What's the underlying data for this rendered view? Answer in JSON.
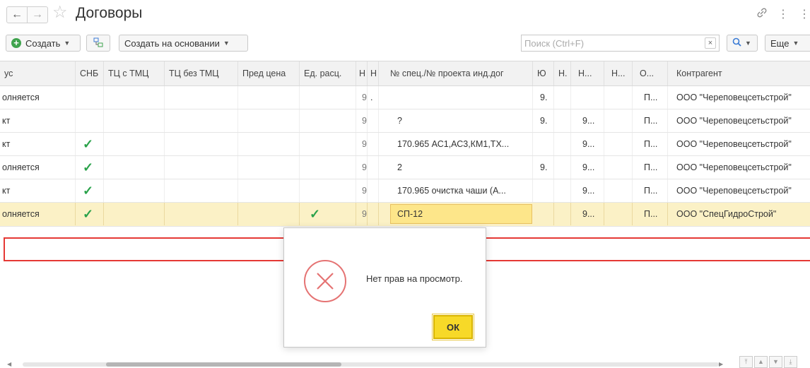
{
  "window": {
    "title": "Договоры",
    "back_icon": "←",
    "forward_icon": "→",
    "star_icon": "☆",
    "link_icon": "🔗",
    "more_icon": "⋮"
  },
  "toolbar": {
    "create_label": "Создать",
    "create_based_label": "Создать на основании",
    "search_placeholder": "Поиск (Ctrl+F)",
    "search_clear": "×",
    "search_button": "🔍",
    "more_label": "Еще"
  },
  "table": {
    "columns": [
      "ус",
      "СНБ",
      "ТЦ с ТМЦ",
      "ТЦ без ТМЦ",
      "Пред цена",
      "Ед. расц.",
      "Н",
      "Н",
      "№ спец./№ проекта инд.дог",
      "Ю",
      "Н.",
      "Н...",
      "Н...",
      "О...",
      "Контрагент"
    ],
    "rows": [
      {
        "status": "олняется",
        "snb": "",
        "ed": "",
        "h1": "9",
        "h2": ".",
        "spec": "",
        "yu": "9.",
        "n1": "",
        "n2": "",
        "n3": "",
        "o": "П...",
        "agent": "ООО \"Череповецсетьстрой\""
      },
      {
        "status": "кт",
        "snb": "",
        "ed": "",
        "h1": "9",
        "h2": "",
        "spec": "?",
        "yu": "9.",
        "n1": "",
        "n2": "9...",
        "n3": "",
        "o": "П...",
        "agent": "ООО \"Череповецсетьстрой\""
      },
      {
        "status": "кт",
        "snb": "✓",
        "ed": "",
        "h1": "9",
        "h2": "",
        "spec": "170.965 АС1,АС3,КМ1,ТХ...",
        "yu": "",
        "n1": "",
        "n2": "9...",
        "n3": "",
        "o": "П...",
        "agent": "ООО \"Череповецсетьстрой\""
      },
      {
        "status": "олняется",
        "snb": "✓",
        "ed": "",
        "h1": "9",
        "h2": "",
        "spec": " 2",
        "yu": "9.",
        "n1": "",
        "n2": "9...",
        "n3": "",
        "o": "П...",
        "agent": "ООО \"Череповецсетьстрой\""
      },
      {
        "status": "кт",
        "snb": "✓",
        "ed": "",
        "h1": "9",
        "h2": "",
        "spec": "170.965 очистка чаши (А...",
        "yu": "",
        "n1": "",
        "n2": "9...",
        "n3": "",
        "o": "П...",
        "agent": "ООО \"Череповецсетьстрой\""
      },
      {
        "status": "олняется",
        "snb": "✓",
        "ed": "✓",
        "h1": "9",
        "h2": "",
        "spec": "СП-12",
        "yu": "",
        "n1": "",
        "n2": "9...",
        "n3": "",
        "o": "П...",
        "agent": "ООО \"СпецГидроСтрой\""
      }
    ]
  },
  "dialog": {
    "message": "Нет прав на просмотр.",
    "ok_label": "ОК"
  },
  "colors": {
    "accent_yellow": "#f7d928",
    "selected_row": "#fbf1c6",
    "check_green": "#2aa24a",
    "highlight_red": "#e53935",
    "error_icon": "#e57373"
  }
}
